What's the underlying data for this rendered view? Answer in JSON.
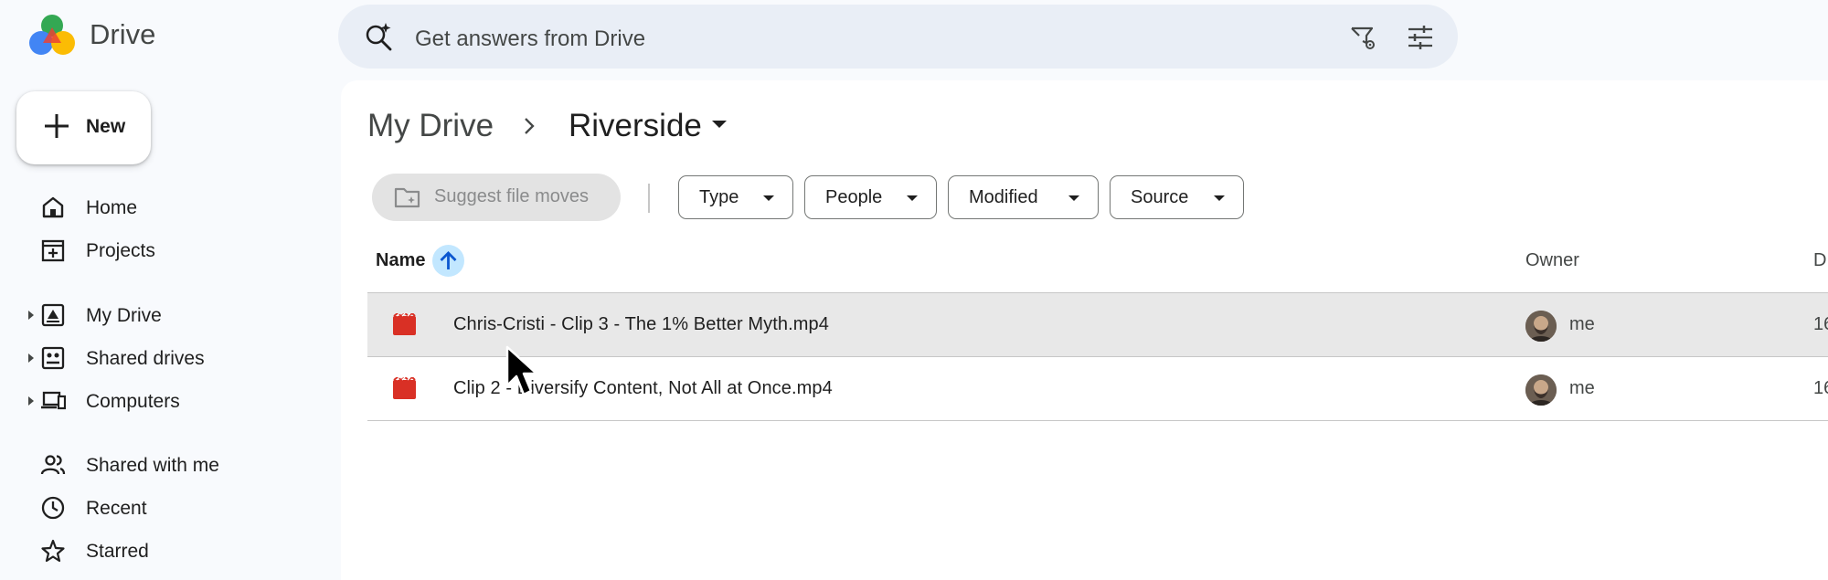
{
  "app": {
    "name": "Drive"
  },
  "search": {
    "placeholder": "Get answers from Drive"
  },
  "sidebar": {
    "new_label": "New",
    "items": [
      {
        "label": "Home"
      },
      {
        "label": "Projects"
      },
      {
        "label": "My Drive"
      },
      {
        "label": "Shared drives"
      },
      {
        "label": "Computers"
      },
      {
        "label": "Shared with me"
      },
      {
        "label": "Recent"
      },
      {
        "label": "Starred"
      }
    ]
  },
  "breadcrumb": {
    "root": "My Drive",
    "current": "Riverside"
  },
  "toolbar": {
    "suggest_label": "Suggest file moves",
    "filters": [
      "Type",
      "People",
      "Modified",
      "Source"
    ]
  },
  "table": {
    "columns": {
      "name": "Name",
      "owner": "Owner",
      "date": "D"
    },
    "rows": [
      {
        "name": "Chris-Cristi - Clip 3 - The 1% Better Myth.mp4",
        "owner": "me",
        "date": "16"
      },
      {
        "name": "Clip 2 - Diversify Content, Not All at Once.mp4",
        "owner": "me",
        "date": "16"
      }
    ]
  },
  "colors": {
    "accent": "#c2e7ff",
    "video_icon": "#d93025",
    "selected_row": "#e8e8e8"
  }
}
